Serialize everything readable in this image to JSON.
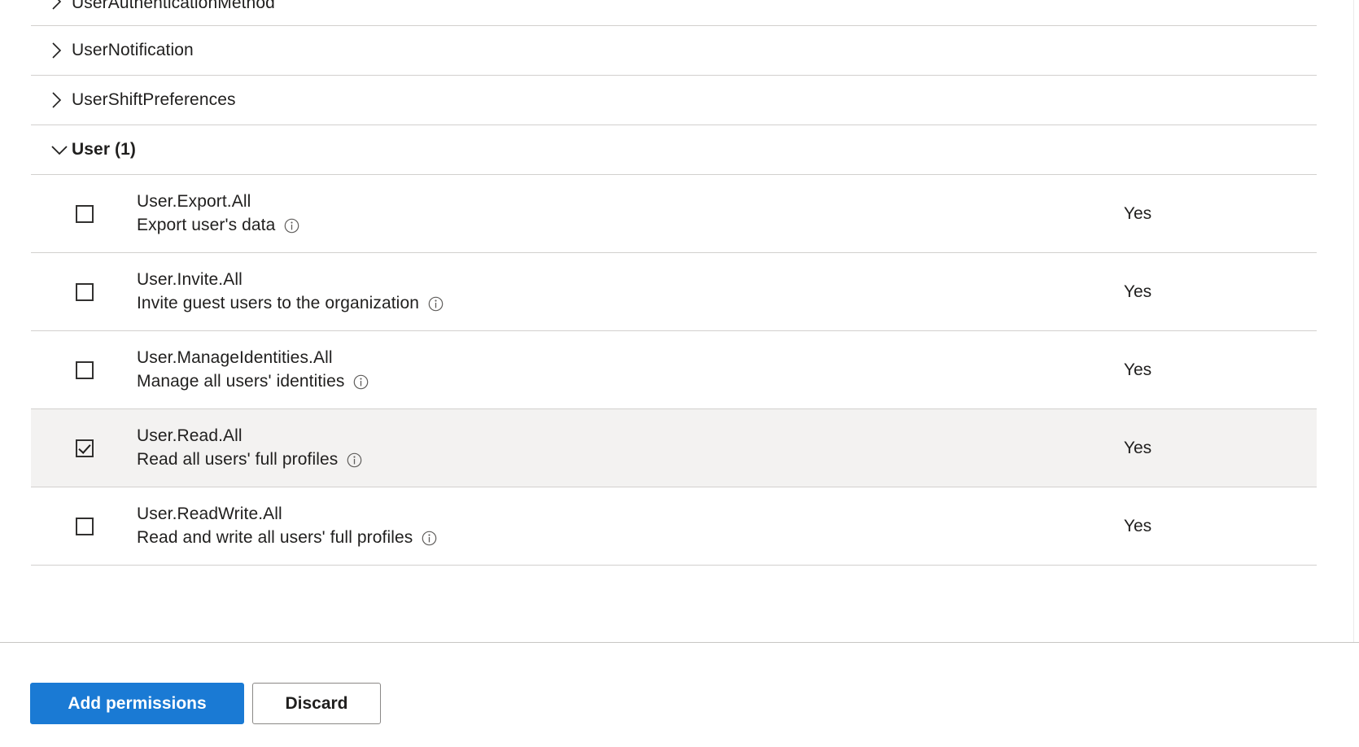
{
  "tree": {
    "collapsed_groups": [
      {
        "label": "UserAuthenticationMethod",
        "chevron": "chevron-right-icon",
        "expanded": false
      },
      {
        "label": "UserNotification",
        "chevron": "chevron-right-icon",
        "expanded": false
      },
      {
        "label": "UserShiftPreferences",
        "chevron": "chevron-right-icon",
        "expanded": false
      }
    ],
    "expanded_group": {
      "label": "User (1)",
      "chevron": "chevron-down-icon",
      "expanded": true
    },
    "permissions": [
      {
        "name": "User.Export.All",
        "description": "Export user's data",
        "info_icon": "info-circle-icon",
        "checked": false,
        "admin_consent_required": "Yes"
      },
      {
        "name": "User.Invite.All",
        "description": "Invite guest users to the organization",
        "info_icon": "info-circle-icon",
        "checked": false,
        "admin_consent_required": "Yes"
      },
      {
        "name": "User.ManageIdentities.All",
        "description": "Manage all users' identities",
        "info_icon": "info-circle-icon",
        "checked": false,
        "admin_consent_required": "Yes"
      },
      {
        "name": "User.Read.All",
        "description": "Read all users' full profiles",
        "info_icon": "info-circle-icon",
        "checked": true,
        "admin_consent_required": "Yes"
      },
      {
        "name": "User.ReadWrite.All",
        "description": "Read and write all users' full profiles",
        "info_icon": "info-circle-icon",
        "checked": false,
        "admin_consent_required": "Yes"
      }
    ]
  },
  "footer": {
    "primary_button": "Add permissions",
    "secondary_button": "Discard"
  },
  "colors": {
    "primary_blue": "#1a7ad4",
    "selected_row": "#f3f2f1",
    "divider": "#d2d0ce",
    "text": "#201f1e",
    "secondary_border": "#8a8886"
  }
}
